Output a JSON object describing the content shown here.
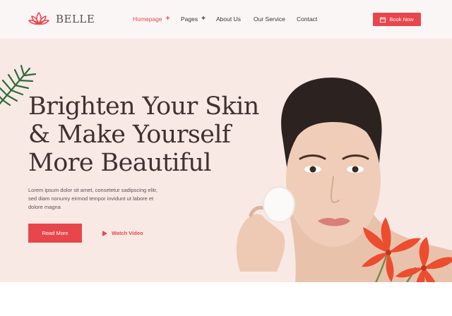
{
  "brand": {
    "name": "BELLE",
    "logo_icon": "lotus-icon",
    "accent": "#e8464d"
  },
  "nav": {
    "items": [
      {
        "label": "Homepage",
        "has_submenu": true,
        "active": true
      },
      {
        "label": "Pages",
        "has_submenu": true,
        "active": false
      },
      {
        "label": "About Us",
        "has_submenu": false,
        "active": false
      },
      {
        "label": "Our Service",
        "has_submenu": false,
        "active": false
      },
      {
        "label": "Contact",
        "has_submenu": false,
        "active": false
      }
    ],
    "submenu_glyph": "+"
  },
  "header": {
    "book_label": "Book Now",
    "book_icon": "calendar-icon"
  },
  "hero": {
    "title_lines": [
      "Brighten Your Skin",
      "& Make Yourself",
      "More Beautiful"
    ],
    "description": "Lorem ipsum dolor sit amet, consetetur sadipscing elitr, sed diam nonumy eirmod tempor invidunt ut labore et dolore magna",
    "read_more_label": "Read More",
    "watch_label": "Watch Video",
    "watch_icon": "play-icon",
    "background": "#f8e9e5"
  }
}
